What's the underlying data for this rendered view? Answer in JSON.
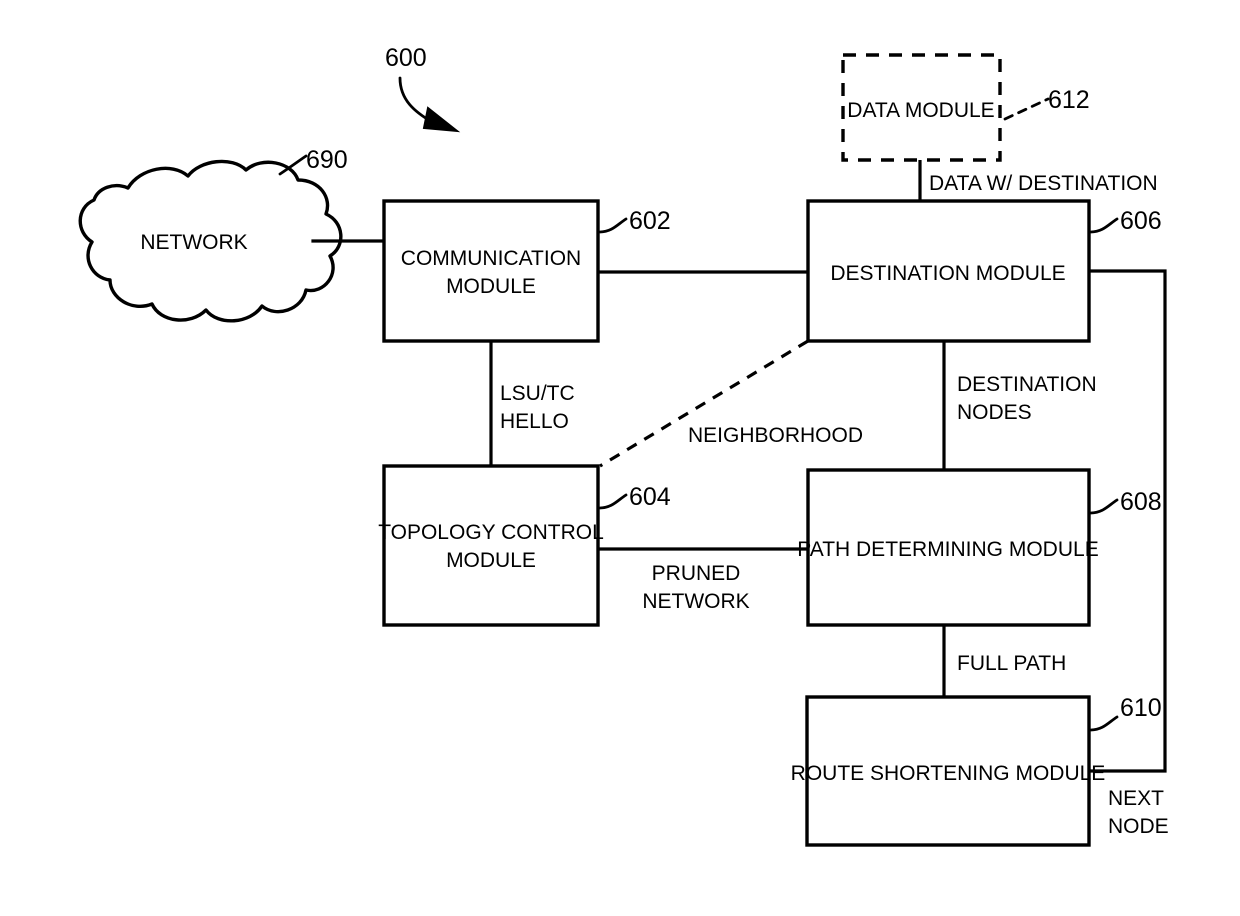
{
  "figure": {
    "number": "600",
    "cloud": {
      "label": "NETWORK",
      "ref": "690"
    },
    "blocks": [
      {
        "id": "data-module",
        "line1": "DATA MODULE",
        "line2": "",
        "ref": "612",
        "style": "dashed"
      },
      {
        "id": "communication-module",
        "line1": "COMMUNICATION",
        "line2": "MODULE",
        "ref": "602",
        "style": "solid"
      },
      {
        "id": "destination-module",
        "line1": "DESTINATION MODULE",
        "line2": "",
        "ref": "606",
        "style": "solid"
      },
      {
        "id": "topology-control-module",
        "line1": "TOPOLOGY CONTROL",
        "line2": "MODULE",
        "ref": "604",
        "style": "solid"
      },
      {
        "id": "path-determining-module",
        "line1": "PATH DETERMINING MODULE",
        "line2": "",
        "ref": "608",
        "style": "solid"
      },
      {
        "id": "route-shortening-module",
        "line1": "ROUTE SHORTENING MODULE",
        "line2": "",
        "ref": "610",
        "style": "solid"
      }
    ],
    "connection_labels": [
      {
        "id": "data-w-destination",
        "line1": "DATA W/ DESTINATION",
        "line2": ""
      },
      {
        "id": "lsu-tc-hello",
        "line1": "LSU/TC",
        "line2": "HELLO"
      },
      {
        "id": "neighborhood",
        "line1": "NEIGHBORHOOD",
        "line2": ""
      },
      {
        "id": "destination-nodes",
        "line1": "DESTINATION",
        "line2": "NODES"
      },
      {
        "id": "pruned-network",
        "line1": "PRUNED",
        "line2": "NETWORK"
      },
      {
        "id": "full-path",
        "line1": "FULL PATH",
        "line2": ""
      },
      {
        "id": "next-node",
        "line1": "NEXT",
        "line2": "NODE"
      }
    ],
    "colors": {
      "stroke": "#000000",
      "background": "#ffffff"
    }
  }
}
